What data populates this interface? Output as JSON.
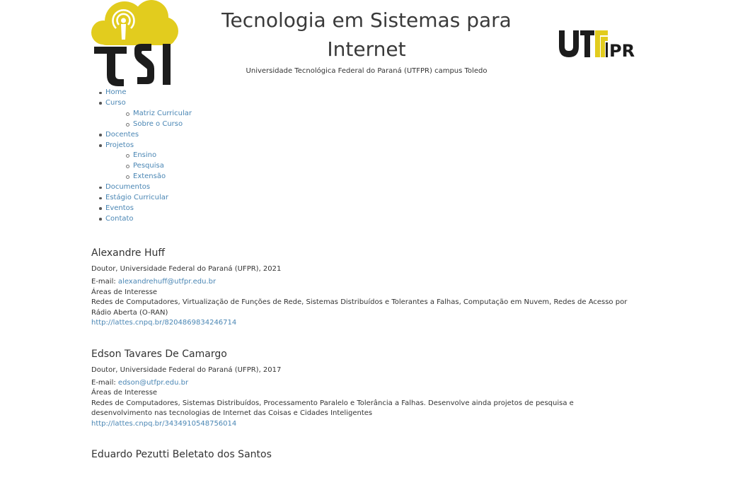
{
  "header": {
    "title": "Tecnologia em Sistemas para Internet",
    "subtitle": "Universidade Tecnológica Federal do Paraná (UTFPR) campus Toledo",
    "logo_left_text": "TSI",
    "logo_right_text": "UTFPR",
    "colors": {
      "brand_yellow": "#e2cc1e",
      "dark": "#1c1c1c",
      "link": "#4a86b4"
    }
  },
  "nav": {
    "home": "Home",
    "curso": "Curso",
    "matriz": "Matriz Curricular",
    "sobre": "Sobre o Curso",
    "docentes": "Docentes",
    "projetos": "Projetos",
    "ensino": "Ensino",
    "pesquisa": "Pesquisa",
    "extensao": "Extensão",
    "documentos": "Documentos",
    "estagio": "Estágio Curricular",
    "eventos": "Eventos",
    "contato": "Contato"
  },
  "people": [
    {
      "name": "Alexandre Huff",
      "degree": "Doutor, Universidade Federal do Paraná (UFPR), 2021",
      "email_label": "E-mail:",
      "email": "alexandrehuff@utfpr.edu.br",
      "interests_label": "Áreas de Interesse",
      "interests": "Redes de Computadores, Virtualização de Funções de Rede, Sistemas Distribuídos e Tolerantes a Falhas, Computação em Nuvem, Redes de Acesso por Rádio Aberta (O-RAN)",
      "lattes": "http://lattes.cnpq.br/8204869834246714"
    },
    {
      "name": "Edson Tavares De Camargo",
      "degree": "Doutor, Universidade Federal do Paraná (UFPR), 2017",
      "email_label": "E-mail:",
      "email": "edson@utfpr.edu.br",
      "interests_label": "Áreas de Interesse",
      "interests": "Redes de Computadores, Sistemas Distribuídos, Processamento Paralelo e Tolerância a Falhas. Desenvolve ainda projetos de pesquisa e desenvolvimento nas tecnologias de Internet das Coisas e Cidades Inteligentes",
      "lattes": "http://lattes.cnpq.br/3434910548756014"
    },
    {
      "name": "Eduardo Pezutti Beletato dos Santos"
    }
  ]
}
